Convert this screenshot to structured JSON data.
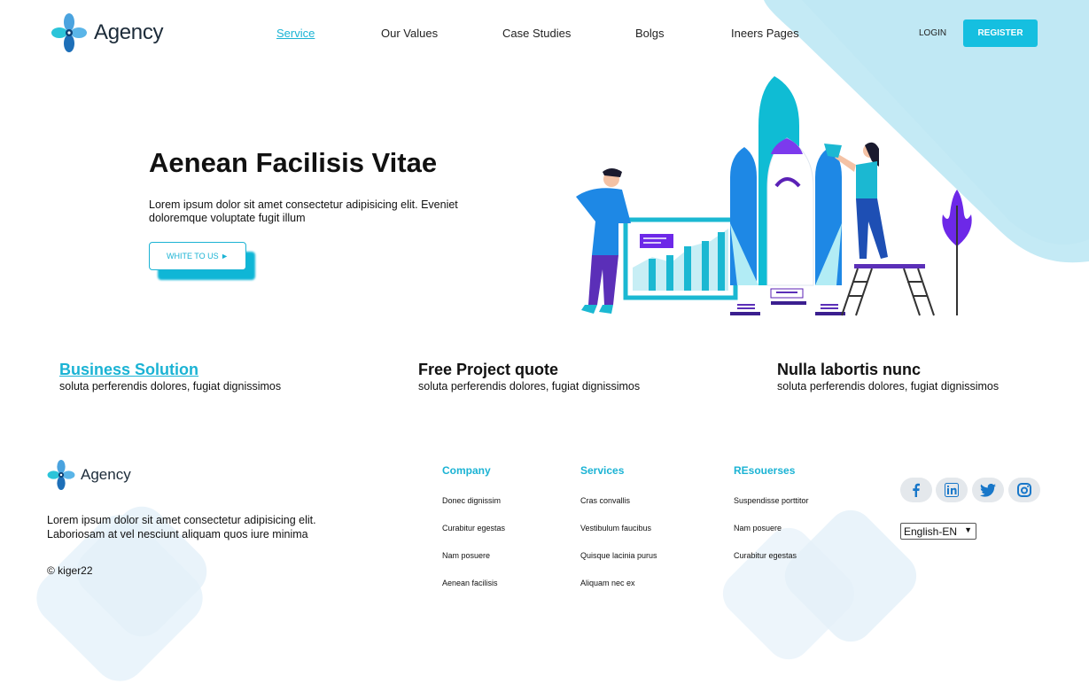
{
  "header": {
    "logo": "Agency",
    "nav": [
      {
        "label": "Service",
        "active": true
      },
      {
        "label": "Our Values",
        "active": false
      },
      {
        "label": "Case Studies",
        "active": false
      },
      {
        "label": "Bolgs",
        "active": false
      },
      {
        "label": "Ineers Pages",
        "active": false
      }
    ],
    "login": "LOGIN",
    "register": "REGISTER"
  },
  "hero": {
    "title": "Aenean Facilisis Vitae",
    "text": "Lorem ipsum dolor sit amet consectetur adipisicing elit. Eveniet doloremque voluptate fugit illum",
    "cta": "WHITE TO US ►"
  },
  "features": [
    {
      "title": "Business Solution",
      "sub": "soluta perferendis dolores, fugiat dignissimos",
      "link": true
    },
    {
      "title": "Free Project quote",
      "sub": "soluta perferendis dolores, fugiat dignissimos",
      "link": false
    },
    {
      "title": "Nulla labortis nunc",
      "sub": "soluta perferendis dolores, fugiat dignissimos",
      "link": false
    }
  ],
  "footer": {
    "logo": "Agency",
    "text": "Lorem ipsum dolor sit amet consectetur adipisicing elit. Laboriosam at vel nesciunt aliquam quos iure minima",
    "copyright": "© kiger22",
    "columns": [
      {
        "heading": "Company",
        "items": [
          "Donec dignissim",
          "Curabitur egestas",
          "Nam posuere",
          "Aenean facilisis"
        ]
      },
      {
        "heading": "Services",
        "items": [
          "Cras convallis",
          "Vestibulum faucibus",
          "Quisque lacinia purus",
          "Aliquam nec ex"
        ]
      },
      {
        "heading": "REsouerses",
        "items": [
          "Suspendisse porttitor",
          "Nam posuere",
          "Curabitur egestas"
        ]
      }
    ],
    "social": [
      "facebook-icon",
      "linkedin-icon",
      "twitter-icon",
      "instagram-icon"
    ],
    "language": "English-EN"
  },
  "colors": {
    "accent": "#1bb3d4",
    "register_bg": "#15bfe0",
    "light_blue": "#c4eaf5"
  }
}
